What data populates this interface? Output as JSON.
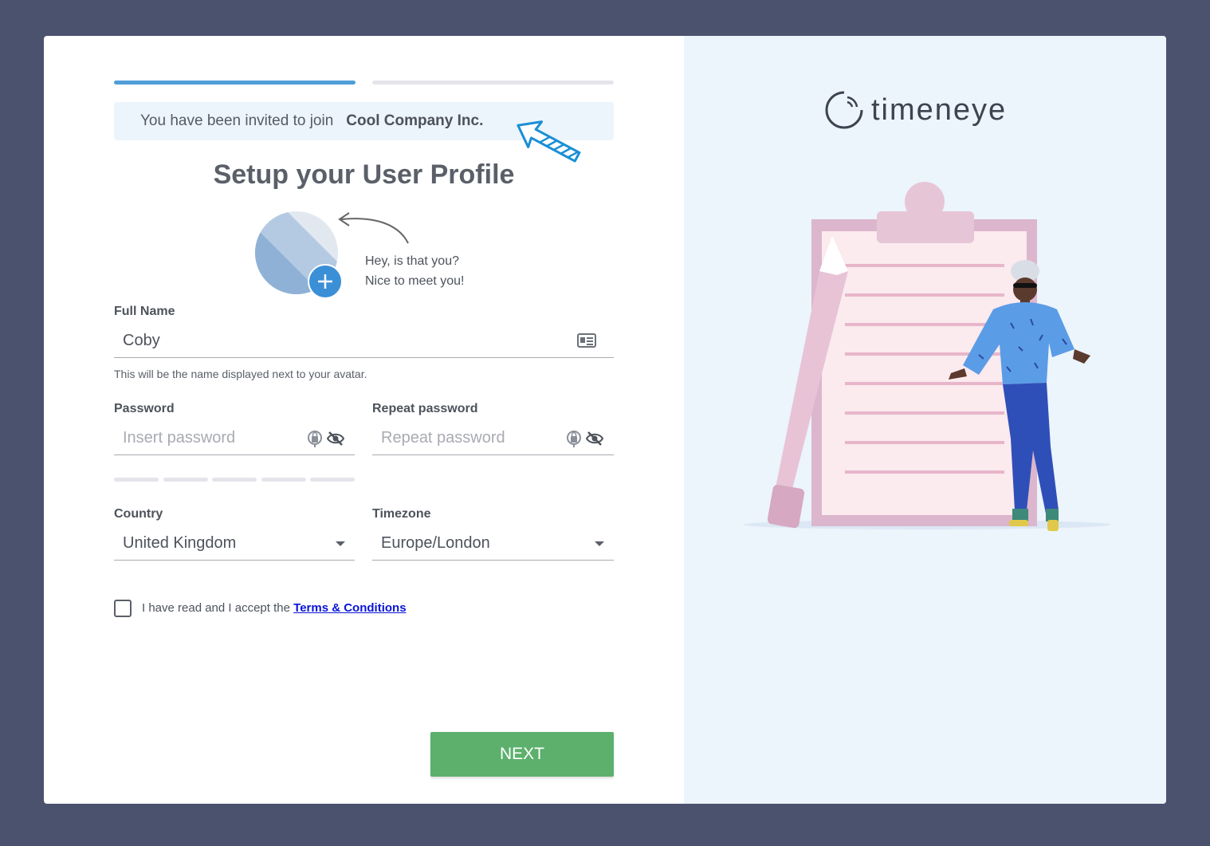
{
  "progress": {
    "current_step": 1,
    "total_steps": 2
  },
  "invite": {
    "prefix": "You have been invited to join",
    "company": "Cool Company Inc."
  },
  "page_title": "Setup your User Profile",
  "avatar": {
    "caption_line1": "Hey, is that you?",
    "caption_line2": "Nice to meet you!"
  },
  "full_name": {
    "label": "Full Name",
    "value": "Coby",
    "hint": "This will be the name displayed next to your avatar."
  },
  "password": {
    "label": "Password",
    "placeholder": "Insert password"
  },
  "repeat_password": {
    "label": "Repeat password",
    "placeholder": "Repeat password"
  },
  "password_strength": {
    "segments": 5,
    "filled": 0
  },
  "country": {
    "label": "Country",
    "value": "United Kingdom"
  },
  "timezone": {
    "label": "Timezone",
    "value": "Europe/London"
  },
  "terms": {
    "prefix": "I have read and I accept the",
    "link": "Terms & Conditions",
    "checked": false
  },
  "next_button": "NEXT",
  "brand": {
    "name": "timeneye"
  },
  "colors": {
    "accent": "#4e9ed8",
    "button": "#5cb06c",
    "background": "#4a526e",
    "panel": "#ecf4fc"
  }
}
